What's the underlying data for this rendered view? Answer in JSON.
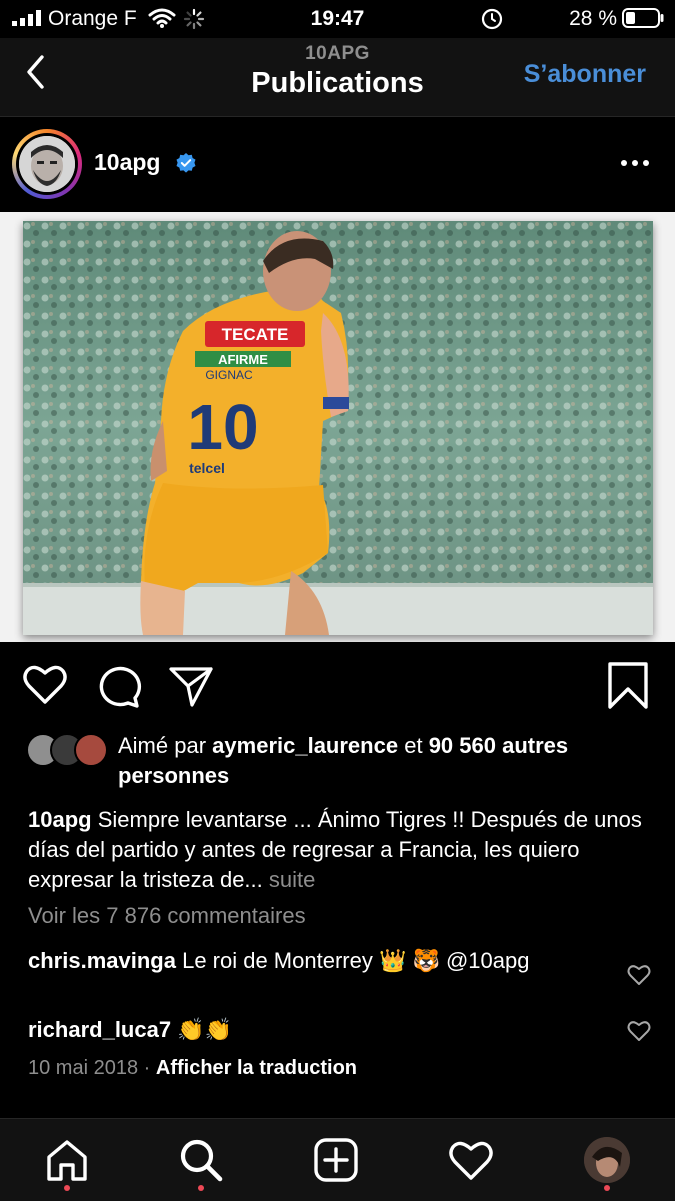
{
  "status_bar": {
    "carrier": "Orange F",
    "time": "19:47",
    "battery": "28 %"
  },
  "nav": {
    "subtitle": "10APG",
    "title": "Publications",
    "follow": "S’abonner"
  },
  "post": {
    "username": "10apg",
    "image": {
      "jersey_sponsor": "TECATE",
      "jersey_chest": "AFIRME",
      "jersey_name": "GIGNAC",
      "jersey_number": "10",
      "jersey_brand": "telcel"
    },
    "likes": {
      "prefix": "Aimé par",
      "user": "aymeric_laurence",
      "joiner": "et",
      "count": "90 560 autres personnes"
    },
    "caption": {
      "text": "Siempre levantarse ... Ánimo Tigres !! Después de unos días del partido y antes de regresar a Francia, les quiero expresar la tristeza de...",
      "more": "suite"
    },
    "view_comments": "Voir les 7 876 commentaires",
    "comments": [
      {
        "user": "chris.mavinga",
        "text": "Le roi de Monterrey 👑 🐯 @10apg"
      },
      {
        "user": "richard_luca7",
        "text": "👏👏"
      }
    ],
    "date": "10 mai 2018",
    "date_sep": "·",
    "translate": "Afficher la traduction"
  },
  "colors": {
    "accent": "#4a8ed8",
    "verified": "#3897f0",
    "notification_dot": "#ed4956",
    "muted_text": "#8e8e8e"
  },
  "icons": {
    "status": [
      "signal-icon",
      "wifi-icon",
      "loading-icon",
      "alarm-icon",
      "battery-icon"
    ],
    "actions": [
      "heart-icon",
      "comment-icon",
      "share-icon",
      "bookmark-icon"
    ],
    "tabs": [
      "home-icon",
      "search-icon",
      "add-icon",
      "heart-icon",
      "profile-avatar"
    ]
  }
}
